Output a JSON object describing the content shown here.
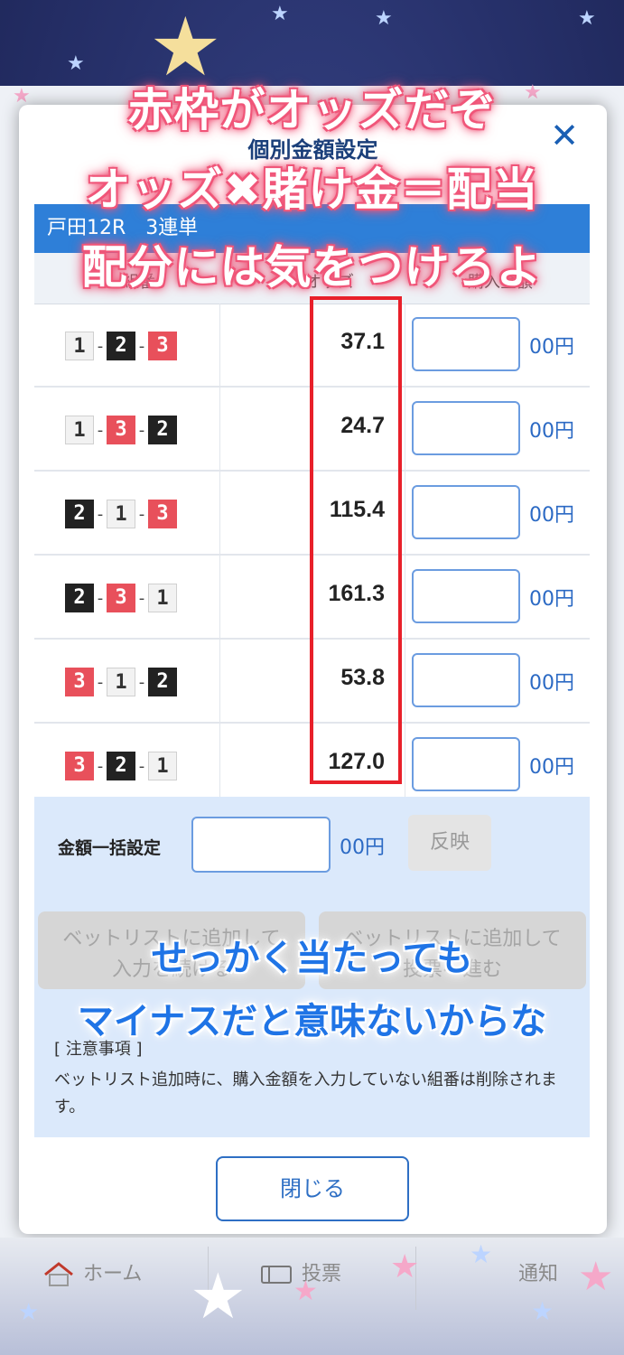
{
  "modal": {
    "title": "個別金額設定",
    "close_icon": "close-icon",
    "race_label": "戸田12R　3連単",
    "columns": [
      "組番",
      "オッズ",
      "購入金額"
    ],
    "unit": "00円",
    "rows": [
      {
        "combo": [
          "1",
          "2",
          "3"
        ],
        "odds": "37.1"
      },
      {
        "combo": [
          "1",
          "3",
          "2"
        ],
        "odds": "24.7"
      },
      {
        "combo": [
          "2",
          "1",
          "3"
        ],
        "odds": "115.4"
      },
      {
        "combo": [
          "2",
          "3",
          "1"
        ],
        "odds": "161.3"
      },
      {
        "combo": [
          "3",
          "1",
          "2"
        ],
        "odds": "53.8"
      },
      {
        "combo": [
          "3",
          "2",
          "1"
        ],
        "odds": "127.0"
      }
    ],
    "bulk": {
      "label": "金額一括設定",
      "unit": "00円",
      "reflect_label": "反映"
    },
    "actions": {
      "continue_l1": "ベットリストに追加して",
      "continue_l2": "入力を続ける",
      "vote_l1": "ベットリストに追加して",
      "vote_l2": "投票へ進む"
    },
    "notes_title": "[ 注意事項 ]",
    "notes_text": "ベットリスト追加時に、購入金額を入力していない組番は削除されます。",
    "close_label": "閉じる"
  },
  "tabbar": {
    "home": "ホーム",
    "vote": "投票",
    "notify": "通知"
  },
  "overlay": {
    "line1": "赤枠がオッズだぞ",
    "line2": "オッズ✖︎賭け金＝配当",
    "line3": "配分には気をつけろよ",
    "line4": "せっかく当たっても",
    "line5": "マイナスだと意味ないからな"
  },
  "colors": {
    "accent": "#2e7fd8",
    "odds_frame": "#e8202a",
    "boat1": "#f2f2f2",
    "boat2": "#222222",
    "boat3": "#e8505b"
  }
}
